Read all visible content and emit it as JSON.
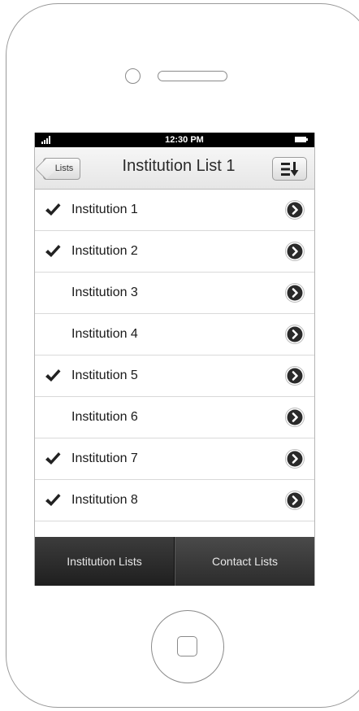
{
  "status_bar": {
    "time": "12:30 PM",
    "signal_icon": "signal-bars-icon",
    "battery_icon": "battery-icon"
  },
  "nav_bar": {
    "back_label": "Lists",
    "title": "Institution List 1",
    "sort_icon": "sort-list-icon"
  },
  "list": {
    "items": [
      {
        "label": "Institution 1",
        "checked": true
      },
      {
        "label": "Institution 2",
        "checked": true
      },
      {
        "label": "Institution 3",
        "checked": false
      },
      {
        "label": "Institution 4",
        "checked": false
      },
      {
        "label": "Institution 5",
        "checked": true
      },
      {
        "label": "Institution 6",
        "checked": false
      },
      {
        "label": "Institution 7",
        "checked": true
      },
      {
        "label": "Institution 8",
        "checked": true
      }
    ],
    "check_icon": "checkmark-icon",
    "disclosure_icon": "chevron-right-circle-icon"
  },
  "tab_bar": {
    "tabs": [
      {
        "label": "Institution Lists",
        "active": true
      },
      {
        "label": "Contact Lists",
        "active": false
      }
    ]
  },
  "colors": {
    "status_bar": "#000000",
    "tab_bar": "#2b2b2b",
    "disclosure": "#2a2a2a"
  }
}
